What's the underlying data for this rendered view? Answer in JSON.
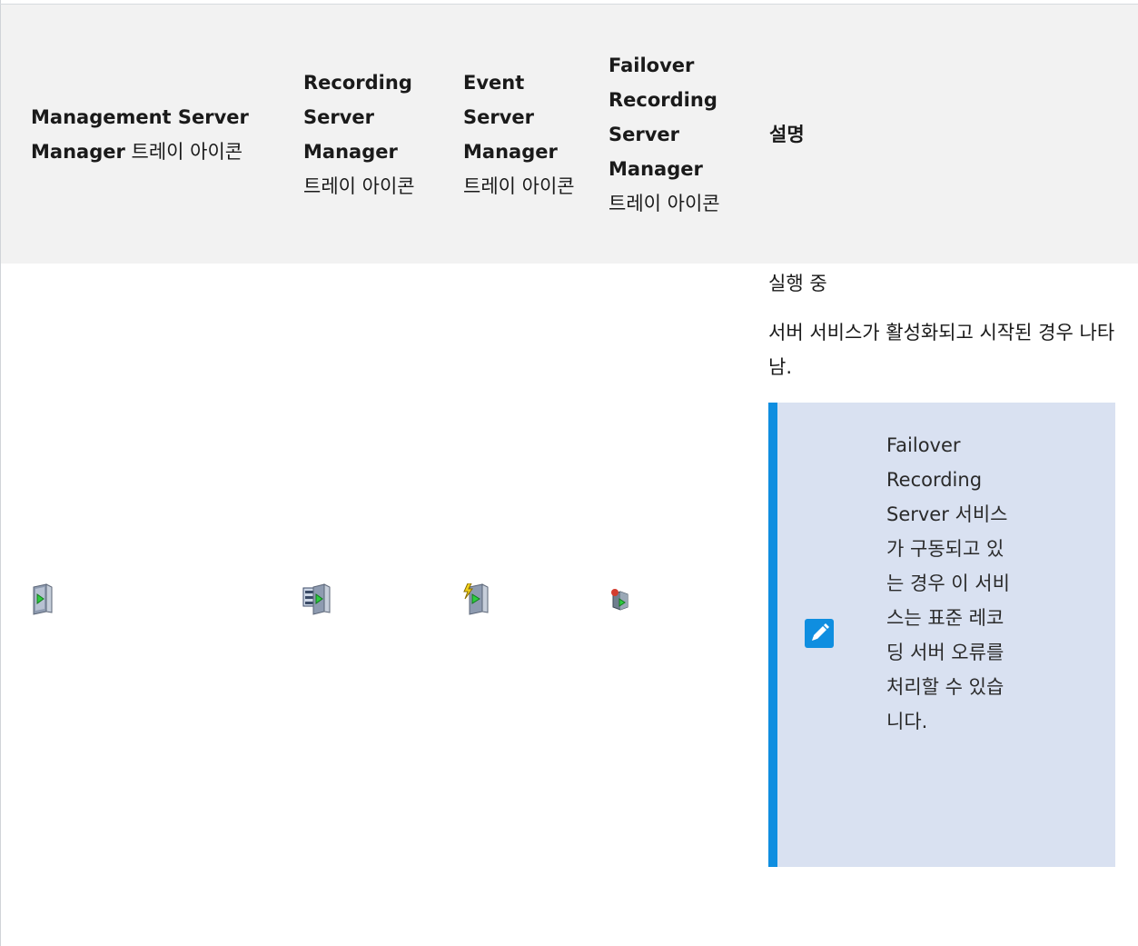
{
  "table": {
    "headers": {
      "col1_bold": "Management Server Manager",
      "col1_rest": "트레이 아이콘",
      "col2_bold": "Recording Server Manager",
      "col2_rest": "트레이 아이콘",
      "col3_bold": "Event Server Manager",
      "col3_rest": "트레이 아이콘",
      "col4_bold": "Failover Recording Server Manager",
      "col4_rest": "트레이 아이콘",
      "col5": "설명"
    },
    "row": {
      "icons": [
        "management-server-running-icon",
        "recording-server-running-icon",
        "event-server-running-icon",
        "failover-recording-server-running-icon"
      ],
      "status": "실행 중",
      "description": "서버 서비스가 활성화되고 시작된 경우 나타남.",
      "note": "Failover Recording Server 서비스가 구동되고 있는 경우 이 서비스는 표준 레코딩 서버 오류를 처리할 수 있습니다."
    }
  },
  "colors": {
    "header_bg": "#f2f2f2",
    "note_bg": "#d9e1f1",
    "note_accent": "#0f8ee0"
  }
}
